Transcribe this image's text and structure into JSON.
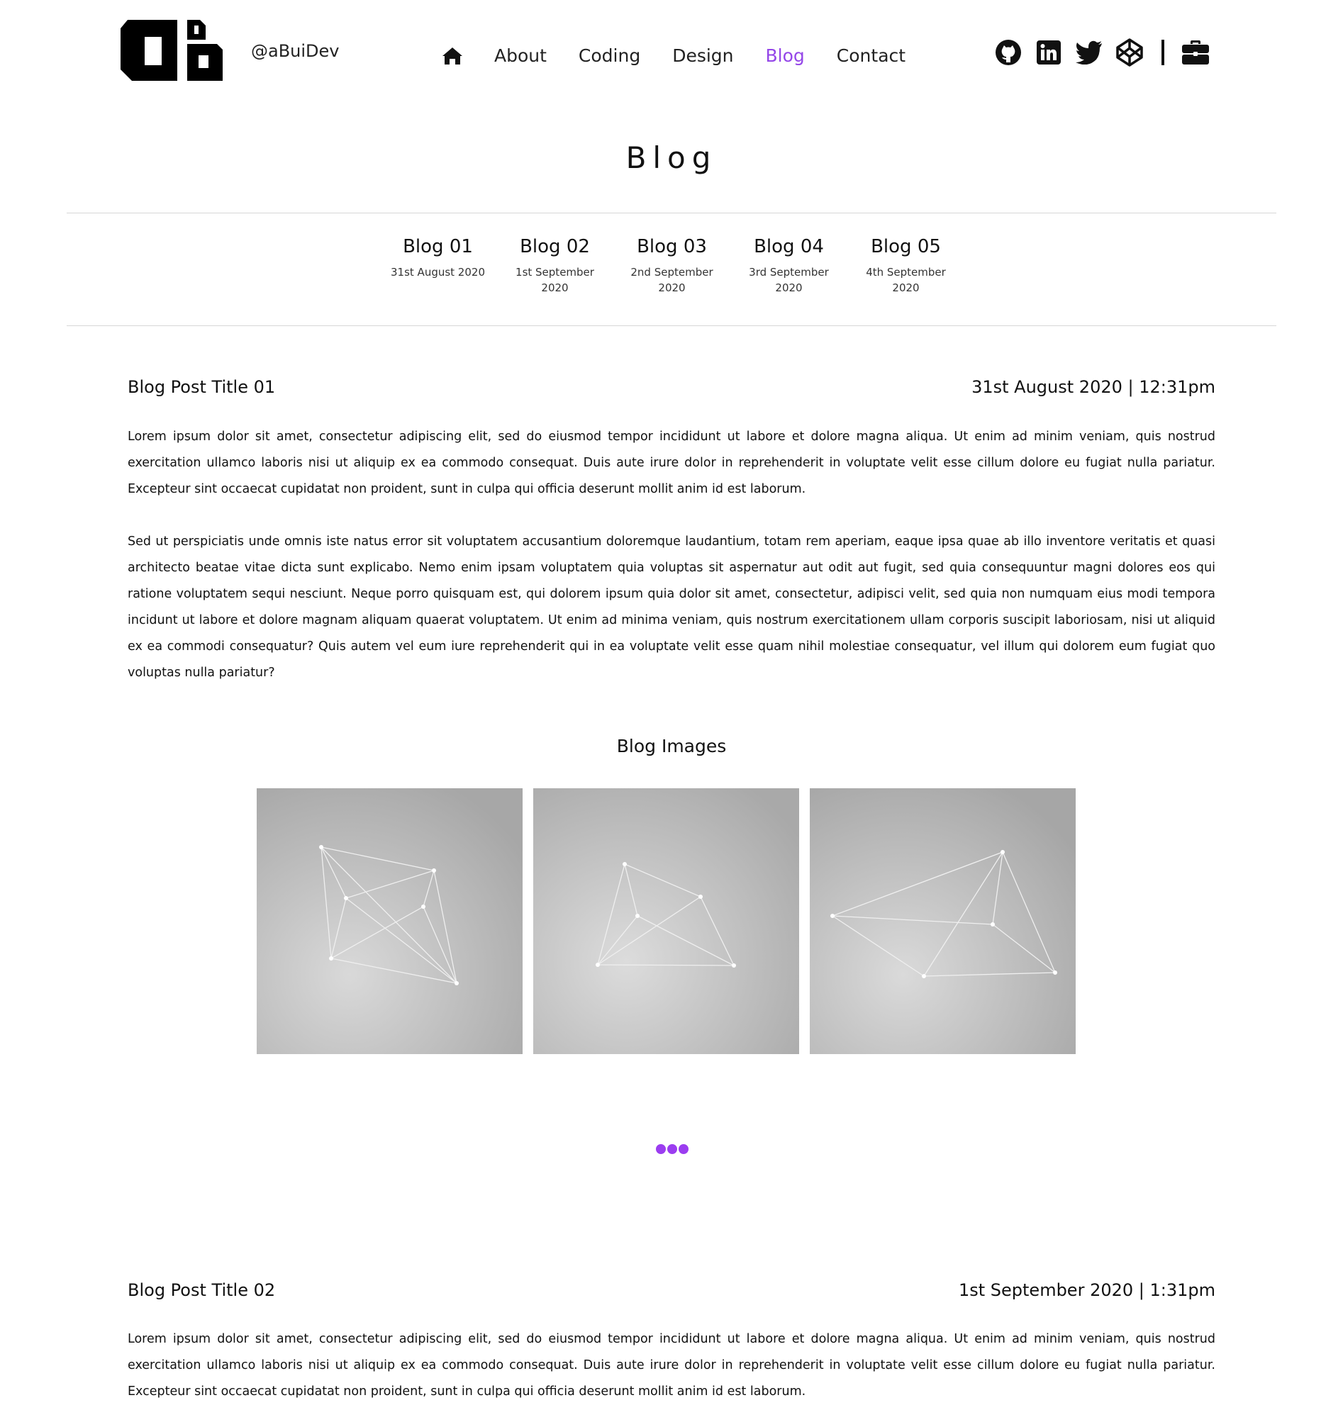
{
  "header": {
    "handle": "@aBuiDev",
    "logo_icon": "ab-monogram-logo",
    "nav": {
      "home_icon": "home-icon",
      "items": [
        "About",
        "Coding",
        "Design",
        "Blog",
        "Contact"
      ],
      "active": "Blog",
      "active_color": "#9446e8"
    },
    "socials": [
      "github-icon",
      "linkedin-icon",
      "twitter-icon",
      "codepen-icon",
      "briefcase-icon"
    ]
  },
  "page_title": "Blog",
  "blog_tabs": [
    {
      "title": "Blog 01",
      "date": "31st August 2020"
    },
    {
      "title": "Blog 02",
      "date": "1st September 2020"
    },
    {
      "title": "Blog 03",
      "date": "2nd September 2020"
    },
    {
      "title": "Blog 04",
      "date": "3rd September 2020"
    },
    {
      "title": "Blog 05",
      "date": "4th September 2020"
    }
  ],
  "posts": [
    {
      "title": "Blog Post Title 01",
      "datetime": "31st August 2020 | 12:31pm",
      "paragraphs": [
        "Lorem ipsum dolor sit amet, consectetur adipiscing elit, sed do eiusmod tempor incididunt ut labore et dolore magna aliqua. Ut enim ad minim veniam, quis nostrud exercitation ullamco laboris nisi ut aliquip ex ea commodo consequat. Duis aute irure dolor in reprehenderit in voluptate velit esse cillum dolore eu fugiat nulla pariatur. Excepteur sint occaecat cupidatat non proident, sunt in culpa qui officia deserunt mollit anim id est laborum.",
        "Sed ut perspiciatis unde omnis iste natus error sit voluptatem accusantium doloremque laudantium, totam rem aperiam, eaque ipsa quae ab illo inventore veritatis et quasi architecto beatae vitae dicta sunt explicabo. Nemo enim ipsam voluptatem quia voluptas sit aspernatur aut odit aut fugit, sed quia consequuntur magni dolores eos qui ratione voluptatem sequi nesciunt. Neque porro quisquam est, qui dolorem ipsum quia dolor sit amet, consectetur, adipisci velit, sed quia non numquam eius modi tempora incidunt ut labore et dolore magnam aliquam quaerat voluptatem. Ut enim ad minima veniam, quis nostrum exercitationem ullam corporis suscipit laboriosam, nisi ut aliquid ex ea commodi consequatur? Quis autem vel eum iure reprehenderit qui in ea voluptate velit esse quam nihil molestiae consequatur, vel illum qui dolorem eum fugiat quo voluptas nulla pariatur?"
      ],
      "images_label": "Blog Images",
      "images": [
        "network-graph-image",
        "network-graph-image",
        "network-graph-image"
      ]
    },
    {
      "title": "Blog Post Title 02",
      "datetime": "1st September 2020 | 1:31pm",
      "paragraphs": [
        "Lorem ipsum dolor sit amet, consectetur adipiscing elit, sed do eiusmod tempor incididunt ut labore et dolore magna aliqua. Ut enim ad minim veniam, quis nostrud exercitation ullamco laboris nisi ut aliquip ex ea commodo consequat. Duis aute irure dolor in reprehenderit in voluptate velit esse cillum dolore eu fugiat nulla pariatur. Excepteur sint occaecat cupidatat non proident, sunt in culpa qui officia deserunt mollit anim id est laborum."
      ]
    }
  ],
  "more_icon": "more-dots-icon",
  "more_color": "#9b3df0"
}
